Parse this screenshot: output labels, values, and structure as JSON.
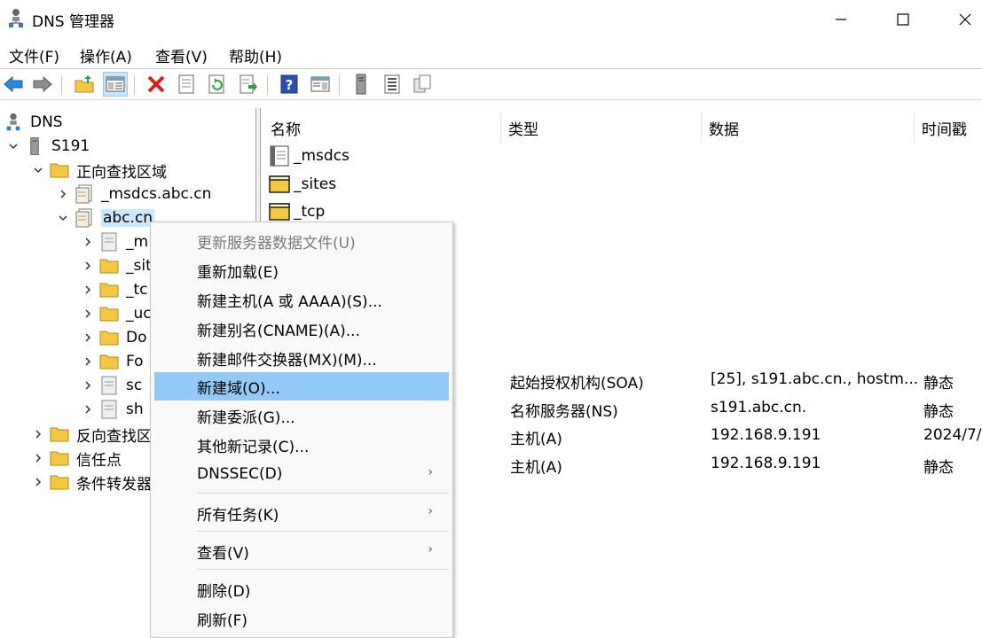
{
  "window": {
    "title": "DNS 管理器"
  },
  "menubar": {
    "items": [
      "文件(F)",
      "操作(A)",
      "查看(V)",
      "帮助(H)"
    ]
  },
  "toolbar": {
    "icons": [
      "back-arrow-icon",
      "forward-arrow-icon",
      "up-folder-icon",
      "show-hide-console-tree-icon",
      "delete-icon",
      "properties-icon",
      "refresh-icon",
      "export-list-icon",
      "help-icon",
      "show-hide-action-pane-icon",
      "server-icon",
      "record-list-icon",
      "copy-icon"
    ]
  },
  "tree": {
    "root": "DNS",
    "server": "S191",
    "forward_zones": "正向查找区域",
    "msdcs_zone": "_msdcs.abc.cn",
    "abc_zone": "abc.cn",
    "abc_children": [
      "_m",
      "_sit",
      "_tc",
      "_uc",
      "Do",
      "Fo",
      "sc",
      "sh"
    ],
    "reverse_zones": "反向查找区",
    "trust_points": "信任点",
    "conditional_forwarders": "条件转发器"
  },
  "list": {
    "columns": [
      "名称",
      "类型",
      "数据",
      "时间戳"
    ],
    "rows": [
      {
        "name": "_msdcs",
        "type": "",
        "data": "",
        "timestamp": ""
      },
      {
        "name": "_sites",
        "type": "",
        "data": "",
        "timestamp": ""
      },
      {
        "name": "_tcp",
        "type": "",
        "data": "",
        "timestamp": ""
      },
      {
        "name": "",
        "type": "起始授权机构(SOA)",
        "data": "[25], s191.abc.cn., hostm...",
        "timestamp": "静态"
      },
      {
        "name": "",
        "type": "名称服务器(NS)",
        "data": "s191.abc.cn.",
        "timestamp": "静态"
      },
      {
        "name": "",
        "type": "主机(A)",
        "data": "192.168.9.191",
        "timestamp": "2024/7/"
      },
      {
        "name": "",
        "type": "主机(A)",
        "data": "192.168.9.191",
        "timestamp": "静态"
      }
    ]
  },
  "context_menu": {
    "items": [
      {
        "label": "更新服务器数据文件(U)",
        "state": "disabled"
      },
      {
        "label": "重新加载(E)",
        "state": "normal"
      },
      {
        "label": "新建主机(A 或 AAAA)(S)...",
        "state": "normal"
      },
      {
        "label": "新建别名(CNAME)(A)...",
        "state": "normal"
      },
      {
        "label": "新建邮件交换器(MX)(M)...",
        "state": "normal"
      },
      {
        "label": "新建域(O)...",
        "state": "hover"
      },
      {
        "label": "新建委派(G)...",
        "state": "normal"
      },
      {
        "label": "其他新记录(C)...",
        "state": "normal"
      },
      {
        "label": "DNSSEC(D)",
        "state": "submenu"
      },
      {
        "label": "所有任务(K)",
        "state": "submenu"
      },
      {
        "label": "查看(V)",
        "state": "submenu"
      },
      {
        "label": "删除(D)",
        "state": "normal"
      },
      {
        "label": "刷新(F)",
        "state": "normal"
      }
    ],
    "submenu_arrow": "›"
  },
  "colors": {
    "selection": "#cce8ff",
    "menu_hover": "#91c9f7",
    "folder": "#f5c842"
  }
}
